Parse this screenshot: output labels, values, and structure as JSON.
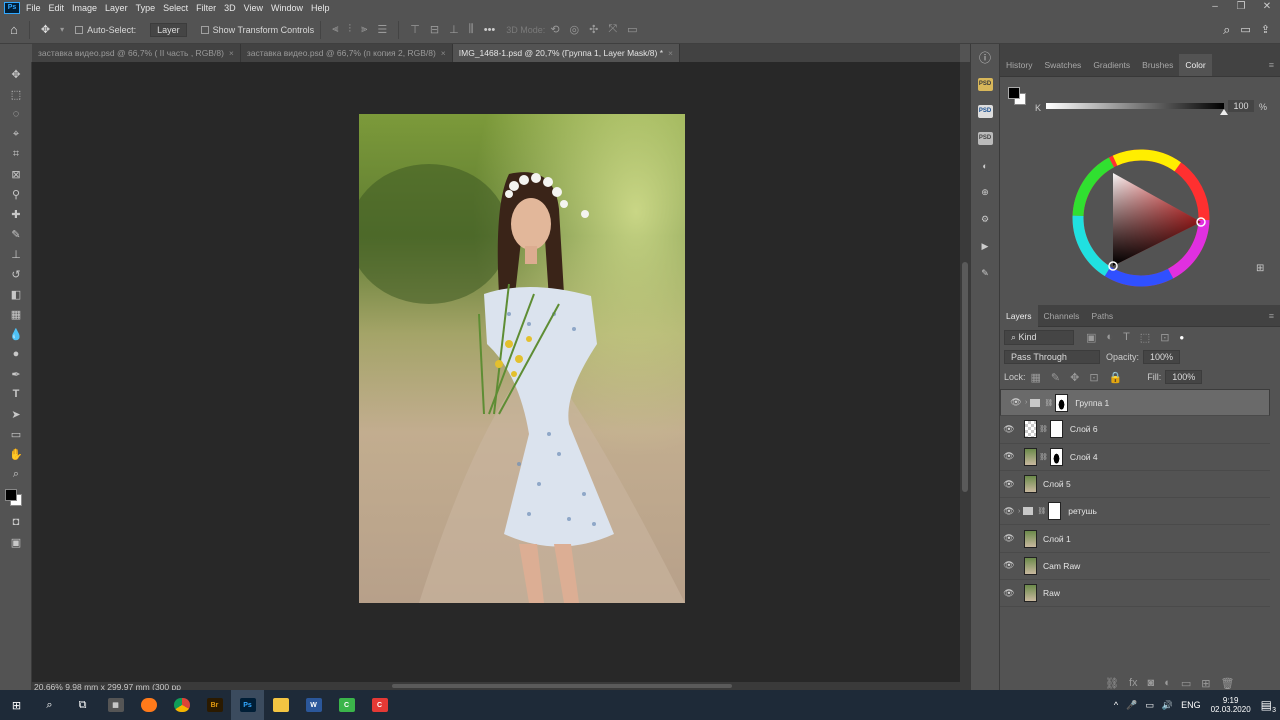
{
  "app_icon": "Ps",
  "menu": [
    "File",
    "Edit",
    "Image",
    "Layer",
    "Type",
    "Select",
    "Filter",
    "3D",
    "View",
    "Window",
    "Help"
  ],
  "options": {
    "auto_select_label": "Auto-Select:",
    "auto_select_value": "Layer",
    "transform_label": "Show Transform Controls",
    "mode_label": "3D Mode:"
  },
  "tabs": [
    {
      "label": "заставка видео.psd @ 66,7% ( II часть  , RGB/8)",
      "close": "×"
    },
    {
      "label": "заставка видео.psd @ 66,7% (п копия 2, RGB/8)",
      "close": "×"
    },
    {
      "label": "IMG_1468-1.psd @ 20,7% (Группа 1, Layer Mask/8) *",
      "close": "×"
    }
  ],
  "status_text": "20,66%  9,98 mm x 299,97 mm (300 pp",
  "color_panel": {
    "tabs": [
      "History",
      "Swatches",
      "Gradients",
      "Brushes",
      "Color"
    ],
    "active_tab": "Color",
    "k_label": "K",
    "k_value": "100",
    "percent": "%",
    "slider_level": 1.0
  },
  "layers_panel": {
    "tabs": [
      "Layers",
      "Channels",
      "Paths"
    ],
    "active_tab": "Layers",
    "filter_value": "Kind",
    "blend_mode": "Pass Through",
    "opacity_label": "Opacity:",
    "opacity_value": "100%",
    "lock_label": "Lock:",
    "fill_label": "Fill:",
    "fill_value": "100%",
    "layers": [
      {
        "name": "Группа 1",
        "kind": "group",
        "selected": true
      },
      {
        "name": "Слой 6",
        "kind": "checker-mask"
      },
      {
        "name": "Слой 4",
        "kind": "photo-mask"
      },
      {
        "name": "Слой 5",
        "kind": "photo"
      },
      {
        "name": "ретушь",
        "kind": "group-white"
      },
      {
        "name": "Слой 1",
        "kind": "photo"
      },
      {
        "name": "Cam Raw",
        "kind": "photo"
      },
      {
        "name": "Raw",
        "kind": "photo"
      }
    ]
  },
  "taskbar": {
    "lang": "ENG",
    "time": "9:19",
    "date": "02.03.2020",
    "notifications": "3"
  },
  "colors": {
    "accent": "#31a8ff",
    "panel": "#535353",
    "canvas_bg": "#282828"
  }
}
